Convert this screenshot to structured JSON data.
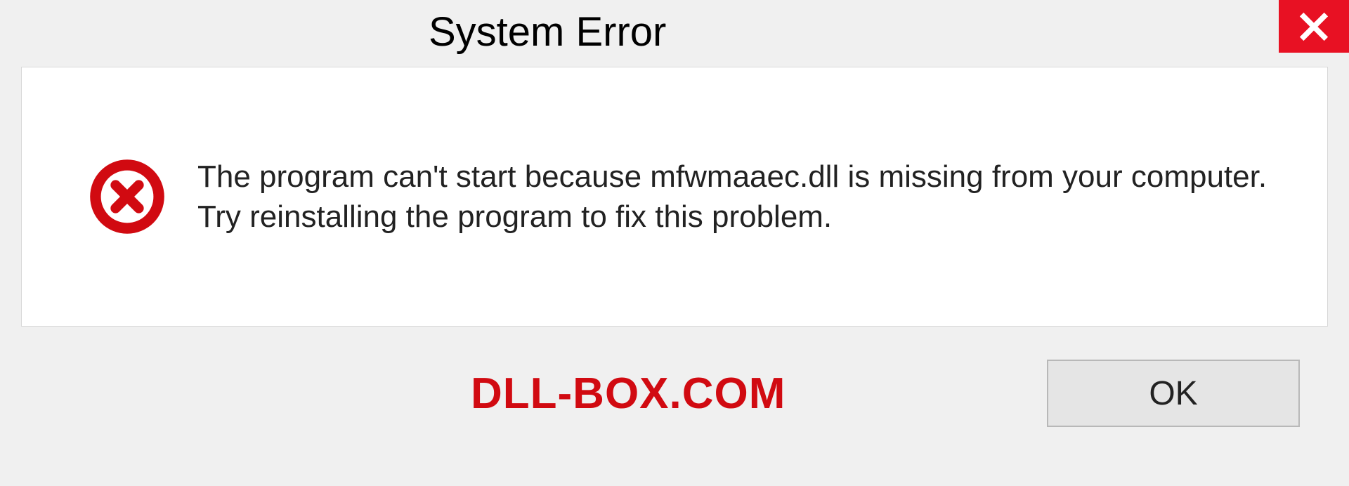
{
  "dialog": {
    "title": "System Error",
    "message": "The program can't start because mfwmaaec.dll is missing from your computer. Try reinstalling the program to fix this problem.",
    "ok_label": "OK"
  },
  "watermark": "DLL-BOX.COM",
  "colors": {
    "close_bg": "#e81123",
    "error_icon": "#d10a11",
    "watermark": "#d10a11"
  },
  "icons": {
    "close": "close-icon",
    "error": "error-circle-x-icon"
  }
}
